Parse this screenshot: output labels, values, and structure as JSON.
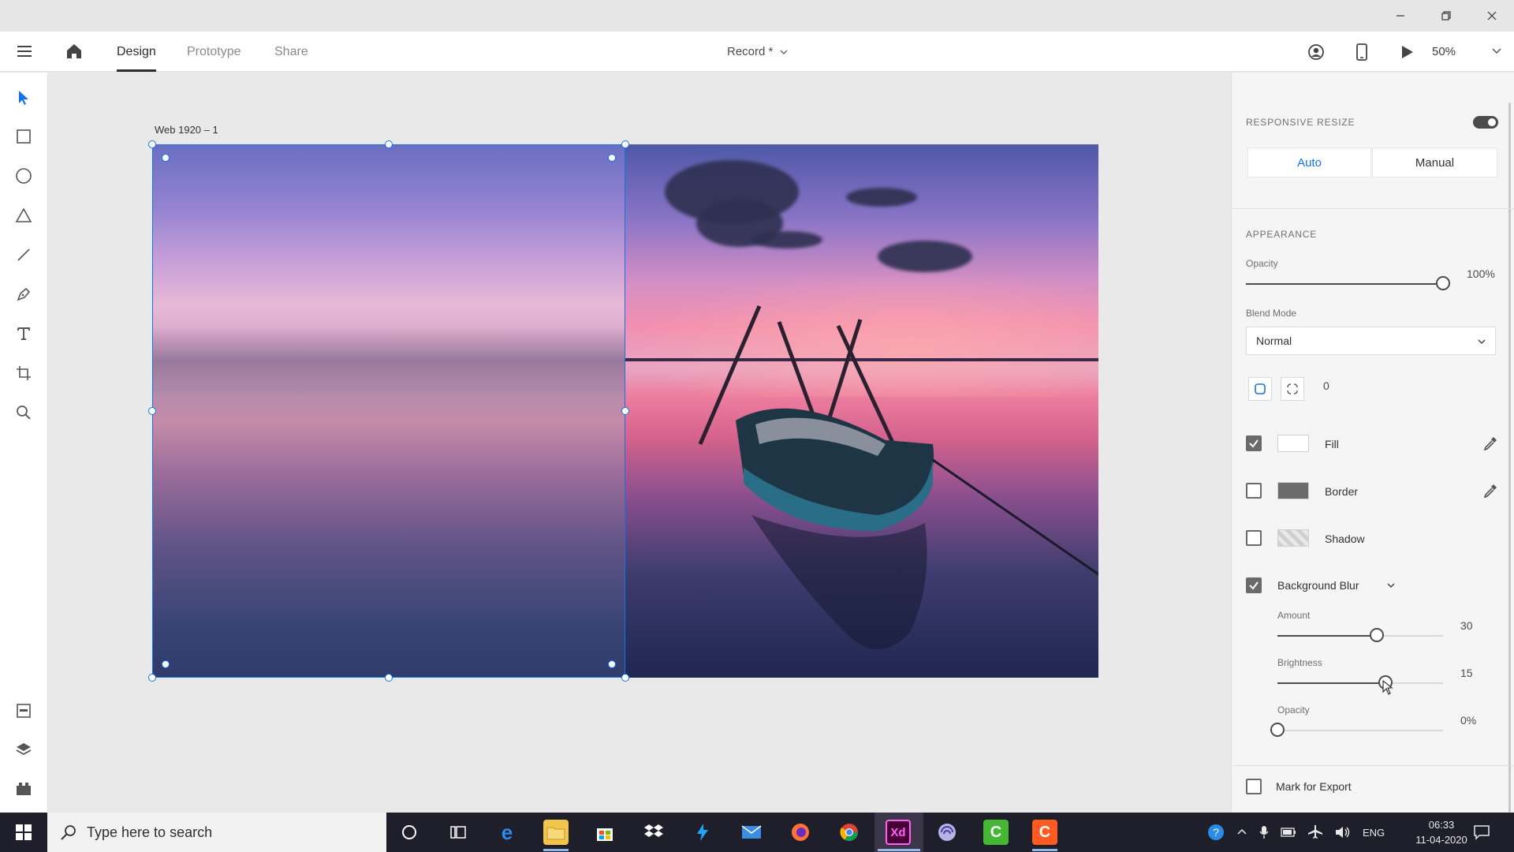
{
  "titlebar": {
    "minimize": "minimize",
    "restore": "restore",
    "close": "close"
  },
  "header": {
    "tabs": [
      {
        "label": "Design"
      },
      {
        "label": "Prototype"
      },
      {
        "label": "Share"
      }
    ],
    "document_title": "Record *",
    "zoom": "50%"
  },
  "artboard": {
    "name": "Web 1920 – 1"
  },
  "panel": {
    "responsive_resize": {
      "title": "RESPONSIVE RESIZE",
      "modes": [
        "Auto",
        "Manual"
      ],
      "active_mode": "Auto",
      "enabled": true
    },
    "appearance": {
      "title": "APPEARANCE",
      "opacity_label": "Opacity",
      "opacity_value": "100%",
      "opacity_level": 1.0,
      "blend_mode_label": "Blend Mode",
      "blend_mode_value": "Normal",
      "corner_radius": "0"
    },
    "fill": {
      "label": "Fill",
      "checked": true,
      "color": "#ffffff"
    },
    "border": {
      "label": "Border",
      "checked": false,
      "color": "#6b6b6b"
    },
    "shadow": {
      "label": "Shadow",
      "checked": false
    },
    "background_blur": {
      "label": "Background Blur",
      "checked": true,
      "amount_label": "Amount",
      "amount_value": "30",
      "amount_level": 0.6,
      "brightness_label": "Brightness",
      "brightness_value": "15",
      "brightness_level": 0.65,
      "opacity_label": "Opacity",
      "opacity_value": "0%",
      "opacity_level": 0.0
    },
    "mark_for_export": {
      "label": "Mark for Export",
      "checked": false
    }
  },
  "taskbar": {
    "search_placeholder": "Type here to search",
    "language": "ENG",
    "time": "06:33",
    "date": "11-04-2020"
  },
  "colors": {
    "accent": "#1473e6",
    "taskbar": "#1f1f2b"
  }
}
